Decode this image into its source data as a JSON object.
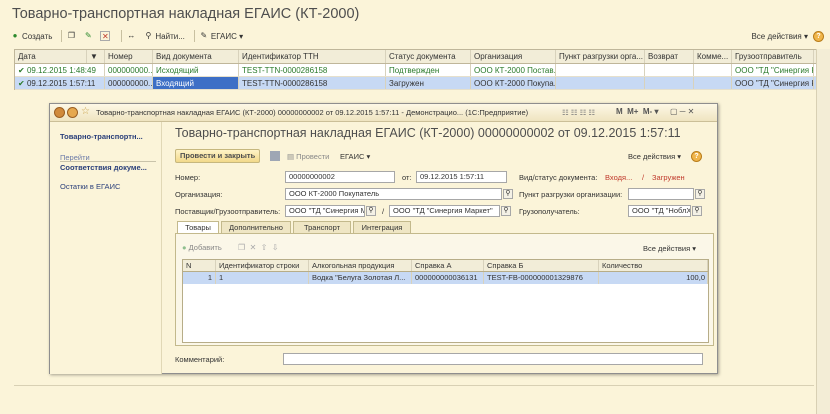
{
  "main": {
    "title": "Товарно-транспортная накладная ЕГАИС (КТ-2000)",
    "toolbar": {
      "create": "Создать",
      "find": "Найти...",
      "egais": "ЕГАИС",
      "all_actions": "Все действия"
    },
    "columns": [
      "Дата",
      "Номер",
      "Вид документа",
      "Идентификатор ТТН",
      "Статус документа",
      "Организация",
      "Пункт разгрузки орга...",
      "Возврат",
      "Комме...",
      "Грузоотправитель"
    ],
    "rows": [
      {
        "date": "09.12.2015 1:48:49",
        "number": "000000000...",
        "doc_type": "Исходящий",
        "ttn": "TEST-TTN-0000286158",
        "status": "Подтвержден",
        "org": "ООО КТ-2000 Постав...",
        "point": "",
        "return": "",
        "comment": "",
        "shipper": "ООО \"ТД \"Синергия К"
      },
      {
        "date": "09.12.2015 1:57:11",
        "number": "000000000...",
        "doc_type": "Входящий",
        "ttn": "TEST-TTN-0000286158",
        "status": "Загружен",
        "org": "ООО КТ-2000 Покупа...",
        "point": "",
        "return": "",
        "comment": "",
        "shipper": "ООО \"ТД \"Синергия К"
      }
    ]
  },
  "window": {
    "caption": "Товарно-транспортная накладная ЕГАИС (КТ-2000) 00000000002 от 09.12.2015 1:57:11 - Демонстрацио... (1С:Предприятие)",
    "sidebar": {
      "current": "Товарно-транспортн...",
      "goto": "Перейти",
      "item1": "Соответствия докуме...",
      "item2": "Остатки в ЕГАИС"
    },
    "form_title": "Товарно-транспортная накладная ЕГАИС (КТ-2000) 00000000002 от 09.12.2015 1:57:11",
    "buttons": {
      "post_close": "Провести и закрыть",
      "post": "Провести",
      "egais": "ЕГАИС",
      "all_actions": "Все действия"
    },
    "fields": {
      "number_label": "Номер:",
      "number_value": "00000000002",
      "from_label": "от:",
      "from_value": "09.12.2015  1:57:11",
      "kind_label": "Вид/статус документа:",
      "kind_value": "Входя...",
      "slash": "/",
      "status_value": "Загружен",
      "org_label": "Организация:",
      "org_value": "ООО КТ-2000 Покупатель",
      "point_label": "Пункт разгрузки организации:",
      "supplier_label": "Поставщик/Грузоотправитель:",
      "supplier_value": "ООО \"ТД \"Синергия М",
      "shipper_value": "ООО \"ТД \"Синергия Маркет\"",
      "consignee_label": "Грузополучатель:",
      "consignee_value": "ООО \"ТД \"НоблХ"
    },
    "tabs": [
      "Товары",
      "Дополнительно",
      "Транспорт",
      "Интеграция"
    ],
    "goods": {
      "add": "Добавить",
      "all_actions": "Все действия",
      "columns": [
        "N",
        "Идентификатор строки",
        "Алкогольная продукция",
        "Справка А",
        "Справка Б",
        "Количество"
      ],
      "row": {
        "n": "1",
        "id": "1",
        "product": "Водка \"Белуга Золотая Л...",
        "ref_a": "000000000036131",
        "ref_b": "TEST-FB-000000001329876",
        "qty": "100,0"
      }
    },
    "comment_label": "Комментарий:"
  }
}
